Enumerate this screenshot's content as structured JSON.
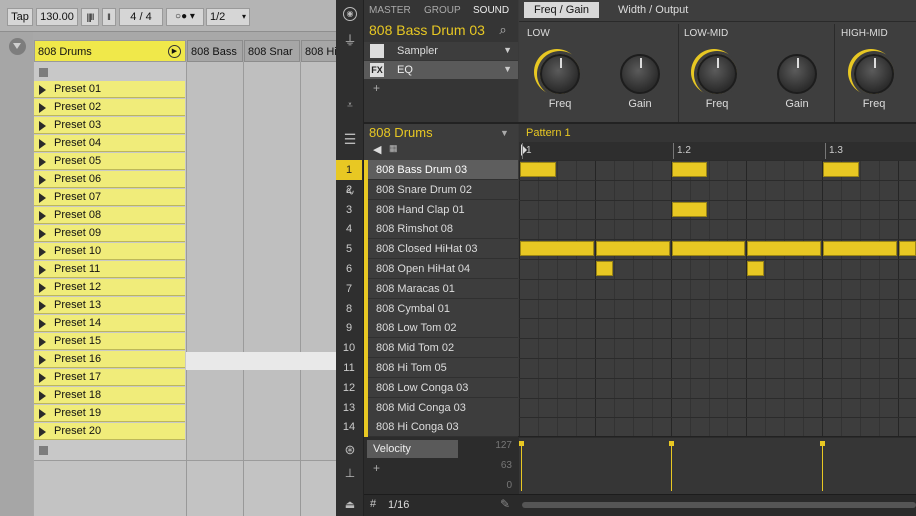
{
  "left": {
    "toolbar": {
      "tap": "Tap",
      "tempo": "130.00",
      "sig_num": "4",
      "sig_sep": "/",
      "sig_den": "4",
      "quant": "1/2"
    },
    "tracks": [
      "808 Drums",
      "808 Bass",
      "808 Snar",
      "808 Hi"
    ],
    "clips": [
      "Preset 01",
      "Preset 02",
      "Preset 03",
      "Preset 04",
      "Preset 05",
      "Preset 06",
      "Preset 07",
      "Preset 08",
      "Preset 09",
      "Preset 10",
      "Preset 11",
      "Preset 12",
      "Preset 13",
      "Preset 14",
      "Preset 15",
      "Preset 16",
      "Preset 17",
      "Preset 18",
      "Preset 19",
      "Preset 20"
    ]
  },
  "right": {
    "tabs": {
      "master": "MASTER",
      "group": "GROUP",
      "sound": "SOUND"
    },
    "sound_name": "808 Bass Drum 03",
    "plugins": [
      {
        "label": "Sampler",
        "icon": "piano-icon"
      },
      {
        "label": "EQ",
        "icon": "fx-icon"
      }
    ],
    "add": "+",
    "page_tabs": [
      "Freq / Gain",
      "Width / Output"
    ],
    "sections": [
      "LOW",
      "LOW-MID",
      "HIGH-MID"
    ],
    "knobs": [
      "Freq",
      "Gain",
      "Freq",
      "Gain",
      "Freq"
    ],
    "group_name": "808 Drums",
    "pattern_name": "Pattern 1",
    "ruler": [
      "1",
      "1.2",
      "1.3"
    ],
    "sounds": [
      "808 Bass Drum 03",
      "808 Snare Drum 02",
      "808 Hand Clap 01",
      "808 Rimshot 08",
      "808 Closed HiHat 03",
      "808 Open HiHat 04",
      "808 Maracas 01",
      "808 Cymbal 01",
      "808 Low Tom 02",
      "808 Mid Tom 02",
      "808 Hi Tom 05",
      "808 Low Conga 03",
      "808 Mid Conga 03",
      "808 Hi Conga 03"
    ],
    "numbers": [
      "1",
      "2",
      "3",
      "4",
      "5",
      "6",
      "7",
      "8",
      "9",
      "10",
      "11",
      "12",
      "13",
      "14"
    ],
    "velocity_label": "Velocity",
    "velocity_scale": [
      "127",
      "63",
      "0"
    ],
    "grid_label": "1/16",
    "accent": "#e8c823"
  }
}
